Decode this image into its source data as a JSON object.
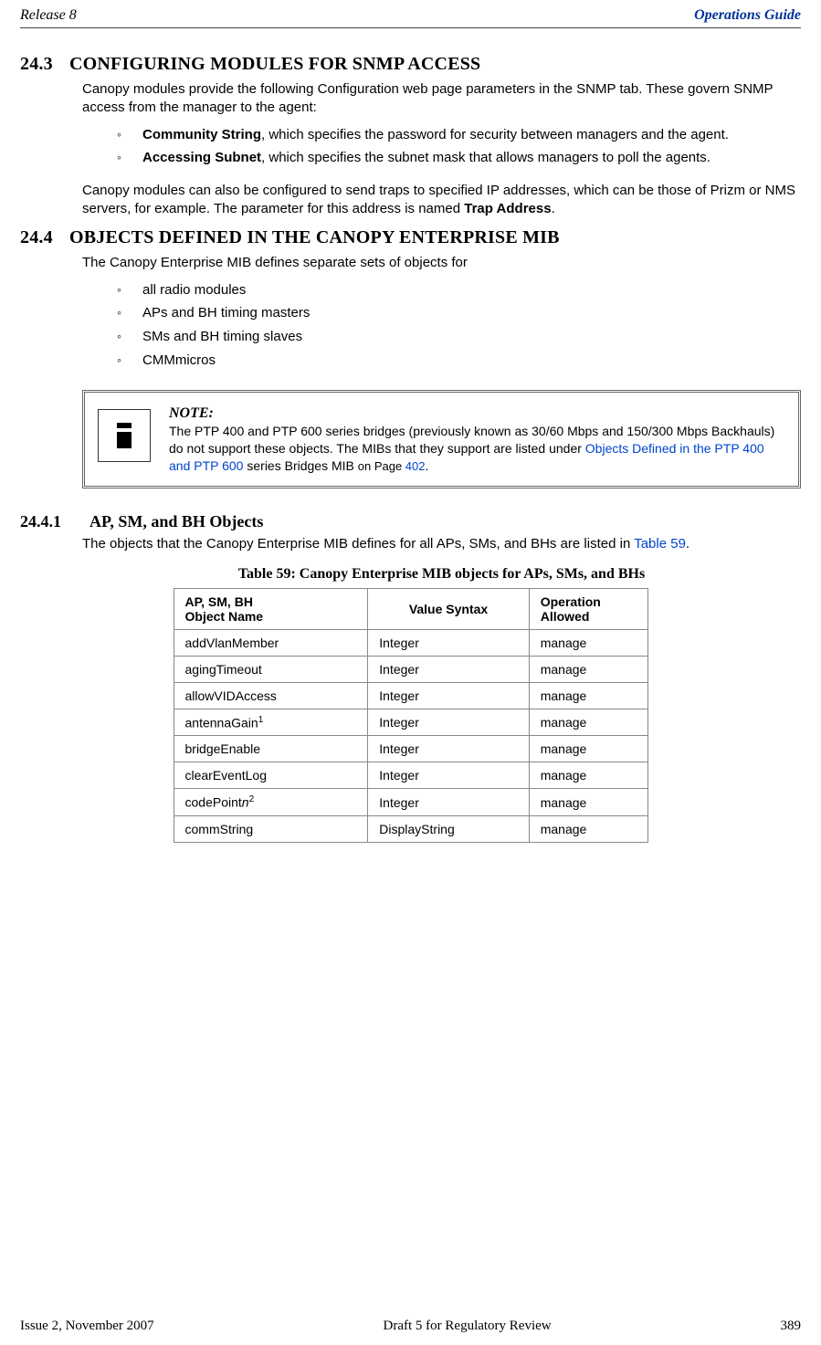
{
  "header": {
    "left": "Release 8",
    "right": "Operations Guide"
  },
  "sections": {
    "s24_3": {
      "num": "24.3",
      "title": "CONFIGURING MODULES FOR SNMP ACCESS",
      "p1": "Canopy modules provide the following Configuration web page parameters in the SNMP tab. These govern SNMP access from the manager to the agent:",
      "bullets": [
        {
          "label": "Community String",
          "rest": ", which specifies the password for security between managers and the agent."
        },
        {
          "label": "Accessing Subnet",
          "rest": ", which specifies the subnet mask that allows managers to poll the agents."
        }
      ],
      "p2_pre": "Canopy modules can also be configured to send traps to specified IP addresses, which can be those of Prizm or NMS servers, for example. The parameter for this address is named ",
      "p2_bold": "Trap Address",
      "p2_post": "."
    },
    "s24_4": {
      "num": "24.4",
      "title": "OBJECTS DEFINED IN THE CANOPY ENTERPRISE MIB",
      "p1": "The Canopy Enterprise MIB defines separate sets of objects for",
      "bullets": [
        "all radio modules",
        "APs and BH timing masters",
        "SMs and BH timing slaves",
        "CMMmicros"
      ]
    },
    "note": {
      "title": "NOTE:",
      "t1": "The PTP 400 and PTP 600 series bridges (previously known as 30/60 Mbps and 150/300 Mbps Backhauls) do not support these objects. The MIBs that they support are listed under ",
      "link": "Objects Defined in the PTP 400 and PTP 600",
      "t2": " series Bridges MIB ",
      "t3": "on Page ",
      "page": "402",
      "t4": "."
    },
    "s24_4_1": {
      "num": "24.4.1",
      "title": "AP, SM, and BH Objects",
      "p1_pre": "The objects that the Canopy Enterprise MIB defines for all APs, SMs, and BHs are listed in ",
      "tref": "Table 59",
      "p1_post": "."
    },
    "table": {
      "caption": "Table 59: Canopy Enterprise MIB objects for APs, SMs, and BHs",
      "headers": {
        "c1a": "AP, SM, BH",
        "c1b": "Object Name",
        "c2": "Value Syntax",
        "c3a": "Operation",
        "c3b": "Allowed"
      }
    }
  },
  "chart_data": {
    "type": "table",
    "columns": [
      "AP, SM, BH Object Name",
      "Value Syntax",
      "Operation Allowed"
    ],
    "rows": [
      {
        "name": "addVlanMember",
        "sup": "",
        "syntax": "Integer",
        "op": "manage"
      },
      {
        "name": "agingTimeout",
        "sup": "",
        "syntax": "Integer",
        "op": "manage"
      },
      {
        "name": "allowVIDAccess",
        "sup": "",
        "syntax": "Integer",
        "op": "manage"
      },
      {
        "name": "antennaGain",
        "sup": "1",
        "syntax": "Integer",
        "op": "manage"
      },
      {
        "name": "bridgeEnable",
        "sup": "",
        "syntax": "Integer",
        "op": "manage"
      },
      {
        "name": "clearEventLog",
        "sup": "",
        "syntax": "Integer",
        "op": "manage"
      },
      {
        "name": "codePoint",
        "italic_suffix": "n",
        "sup": "2",
        "syntax": "Integer",
        "op": "manage"
      },
      {
        "name": "commString",
        "sup": "",
        "syntax": "DisplayString",
        "op": "manage"
      }
    ]
  },
  "footer": {
    "left": "Issue 2, November 2007",
    "center": "Draft 5 for Regulatory Review",
    "right": "389"
  }
}
